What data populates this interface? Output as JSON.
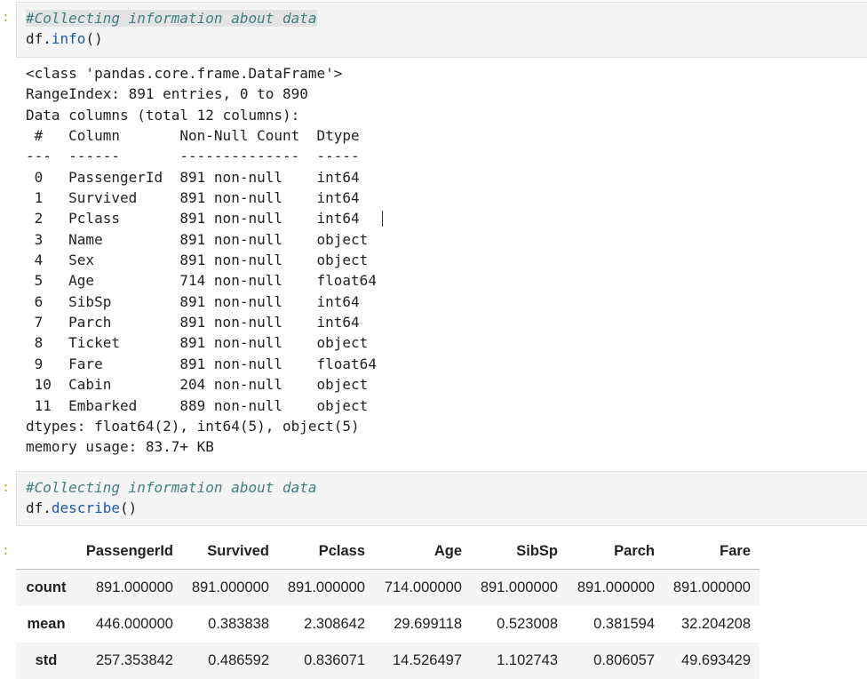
{
  "cell1": {
    "prompt": ":",
    "comment": "#Collecting information about data",
    "code_obj": "df.",
    "code_fn": "info",
    "code_end": "()"
  },
  "info_output": [
    "<class 'pandas.core.frame.DataFrame'>",
    "RangeIndex: 891 entries, 0 to 890",
    "Data columns (total 12 columns):",
    " #   Column       Non-Null Count  Dtype  ",
    "---  ------       --------------  -----  ",
    " 0   PassengerId  891 non-null    int64  ",
    " 1   Survived     891 non-null    int64  ",
    " 2   Pclass       891 non-null    int64  ",
    " 3   Name         891 non-null    object ",
    " 4   Sex          891 non-null    object ",
    " 5   Age          714 non-null    float64",
    " 6   SibSp        891 non-null    int64  ",
    " 7   Parch        891 non-null    int64  ",
    " 8   Ticket       891 non-null    object ",
    " 9   Fare         891 non-null    float64",
    " 10  Cabin        204 non-null    object ",
    " 11  Embarked     889 non-null    object ",
    "dtypes: float64(2), int64(5), object(5)",
    "memory usage: 83.7+ KB"
  ],
  "cell2": {
    "prompt": ":",
    "comment": "#Collecting information about data",
    "code_obj": "df.",
    "code_fn": "describe",
    "code_end": "()"
  },
  "output2_prompt": ":",
  "describe_table": {
    "columns": [
      "",
      "PassengerId",
      "Survived",
      "Pclass",
      "Age",
      "SibSp",
      "Parch",
      "Fare"
    ],
    "rows": [
      {
        "label": "count",
        "values": [
          "891.000000",
          "891.000000",
          "891.000000",
          "714.000000",
          "891.000000",
          "891.000000",
          "891.000000"
        ]
      },
      {
        "label": "mean",
        "values": [
          "446.000000",
          "0.383838",
          "2.308642",
          "29.699118",
          "0.523008",
          "0.381594",
          "32.204208"
        ]
      },
      {
        "label": "std",
        "values": [
          "257.353842",
          "0.486592",
          "0.836071",
          "14.526497",
          "1.102743",
          "0.806057",
          "49.693429"
        ]
      }
    ]
  }
}
